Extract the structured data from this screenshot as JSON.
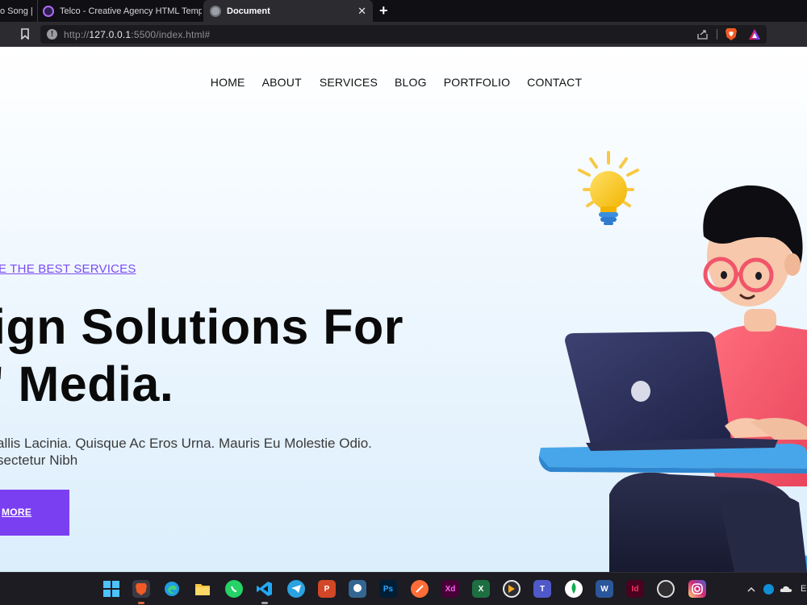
{
  "browser": {
    "tabs": [
      {
        "title": "o Song |"
      },
      {
        "title": "Telco - Creative Agency HTML Templat"
      },
      {
        "title": "Document"
      }
    ],
    "new_tab_symbol": "+",
    "close_symbol": "✕",
    "url_host": "127.0.0.1",
    "url_rest": ":5500/index.html#",
    "url_scheme": "http://"
  },
  "nav": {
    "items": [
      "HOME",
      "ABOUT",
      "SERVICES",
      "BLOG",
      "PORTFOLIO",
      "CONTACT"
    ]
  },
  "hero": {
    "kicker": "E THE BEST SERVICES",
    "headline_line1": "ign Solutions For",
    "headline_line2": "' Media.",
    "description_line1": "allis Lacinia. Quisque Ac Eros Urna. Mauris Eu Molestie Odio.",
    "description_line2": "sectetur Nibh",
    "cta_label": "MORE"
  },
  "taskbar": {
    "apps": [
      "windows-start",
      "brave",
      "edge",
      "file-explorer",
      "whatsapp",
      "vscode",
      "telegram",
      "powerpoint",
      "postgresql",
      "photoshop",
      "postman",
      "xd",
      "excel",
      "media-player",
      "teams",
      "mongodb",
      "word",
      "indesign",
      "obs",
      "instagram"
    ],
    "labels": {
      "ps": "Ps",
      "xd": "Xd",
      "x": "X",
      "p": "P",
      "w": "W",
      "id": "Id",
      "t": "T"
    },
    "tray_text": "E"
  },
  "colors": {
    "accent": "#7b3ff2",
    "kicker": "#7b4cf2",
    "tab_strip": "#0f0f14",
    "toolbar": "#2b2b30"
  }
}
